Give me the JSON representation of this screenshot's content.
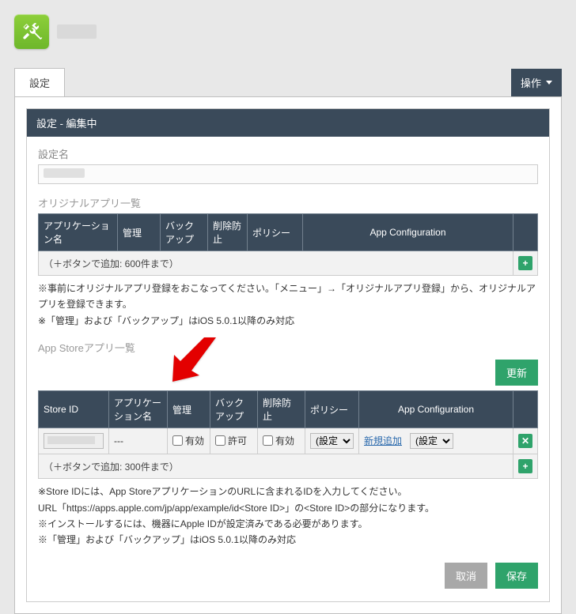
{
  "header": {
    "app_name_placeholder": ""
  },
  "tabs": {
    "settings": "設定"
  },
  "ops_button": "操作",
  "panel": {
    "title": "設定 - 編集中"
  },
  "fields": {
    "setting_name_label": "設定名"
  },
  "original_apps": {
    "heading": "オリジナルアプリ一覧",
    "columns": {
      "app_name": "アプリケーション名",
      "manage": "管理",
      "backup": "バックアップ",
      "delete_protect": "削除防止",
      "policy": "ポリシー",
      "app_config": "App Configuration"
    },
    "limit_note": "（＋ボタンで追加: 600件まで）",
    "notes": "※事前にオリジナルアプリ登録をおこなってください。「メニュー」→「オリジナルアプリ登録」から、オリジナルアプリを登録できます。\n※「管理」および「バックアップ」はiOS 5.0.1以降のみ対応"
  },
  "appstore_apps": {
    "heading": "App Storeアプリ一覧",
    "update_btn": "更新",
    "columns": {
      "store_id": "Store ID",
      "app_name": "アプリケーション名",
      "manage": "管理",
      "backup": "バックアップ",
      "delete_protect": "削除防止",
      "policy": "ポリシー",
      "app_config": "App Configuration"
    },
    "row": {
      "store_id_value": "",
      "app_name_value": "---",
      "manage_label": "有効",
      "backup_label": "許可",
      "delete_protect_label": "有効",
      "policy_select": "(設定",
      "appconfig_link": "新規追加",
      "appconfig_select": "(設定な"
    },
    "limit_note": "（＋ボタンで追加: 300件まで）",
    "notes_1": "※Store IDには、App StoreアプリケーションのURLに含まれるIDを入力してください。",
    "notes_2": "URL「https://apps.apple.com/jp/app/example/id<Store ID>」の<Store ID>の部分になります。",
    "notes_3": "※インストールするには、機器にApple IDが設定済みである必要があります。",
    "notes_4": "※「管理」および「バックアップ」はiOS 5.0.1以降のみ対応"
  },
  "buttons": {
    "cancel": "取消",
    "save": "保存"
  }
}
